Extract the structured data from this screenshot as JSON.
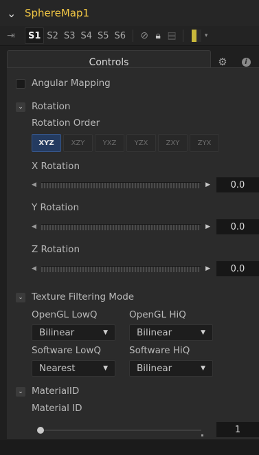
{
  "header": {
    "chevron_icon": "chevron-down-icon",
    "title": "SphereMap1"
  },
  "versions": {
    "items": [
      "S1",
      "S2",
      "S3",
      "S4",
      "S5",
      "S6"
    ],
    "active": "S1"
  },
  "tabs": {
    "controls_label": "Controls"
  },
  "angular_mapping": {
    "label": "Angular Mapping",
    "checked": false
  },
  "rotation": {
    "section_label": "Rotation",
    "order_label": "Rotation Order",
    "orders": [
      "XYZ",
      "XZY",
      "YXZ",
      "YZX",
      "ZXY",
      "ZYX"
    ],
    "active_order": "XYZ",
    "x_label": "X Rotation",
    "x_value": "0.0",
    "y_label": "Y Rotation",
    "y_value": "0.0",
    "z_label": "Z Rotation",
    "z_value": "0.0"
  },
  "texture": {
    "section_label": "Texture Filtering Mode",
    "gl_low_label": "OpenGL LowQ",
    "gl_low_value": "Bilinear",
    "gl_hi_label": "OpenGL HiQ",
    "gl_hi_value": "Bilinear",
    "sw_low_label": "Software LowQ",
    "sw_low_value": "Nearest",
    "sw_hi_label": "Software HiQ",
    "sw_hi_value": "Bilinear"
  },
  "material": {
    "section_label": "MaterialID",
    "label": "Material ID",
    "value": "1"
  },
  "colors": {
    "title": "#f2c744",
    "active_button": "#243b60"
  }
}
